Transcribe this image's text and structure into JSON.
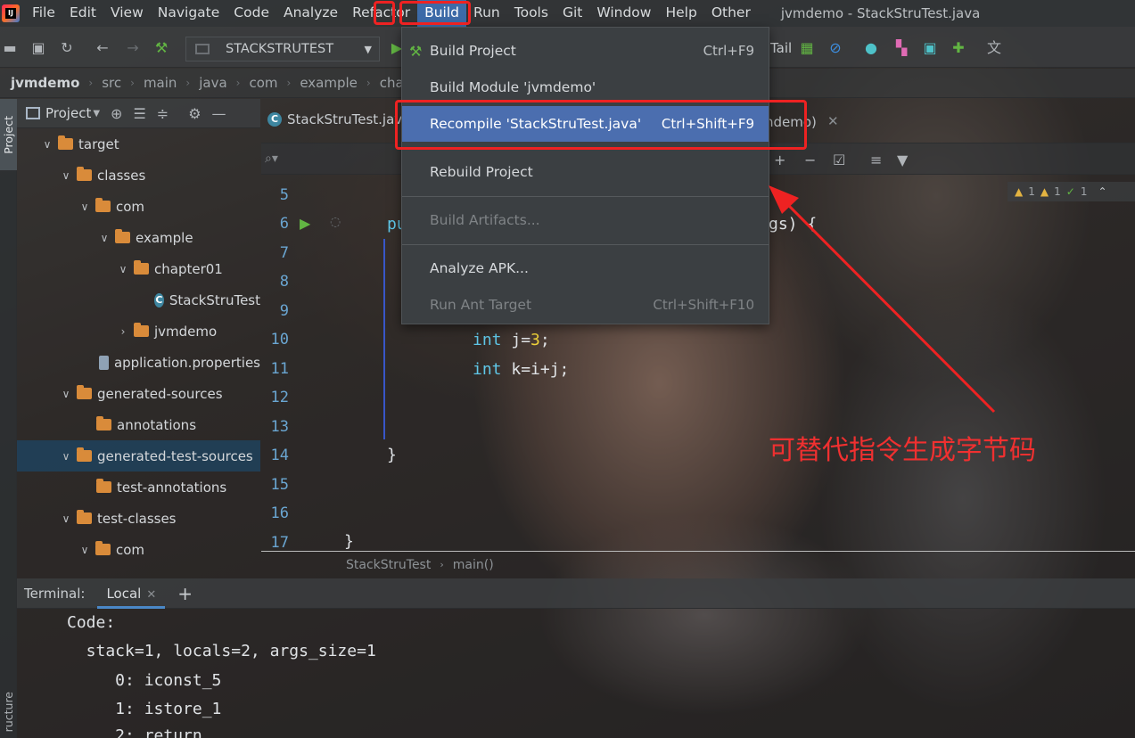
{
  "menubar": {
    "items": [
      "File",
      "Edit",
      "View",
      "Navigate",
      "Code",
      "Analyze",
      "Refactor",
      "Build",
      "Run",
      "Tools",
      "Git",
      "Window",
      "Help",
      "Other"
    ],
    "window_title": "jvmdemo - StackStruTest.java"
  },
  "toolbar": {
    "run_config": "STACKSTRUTEST",
    "tail_text": "Tail"
  },
  "breadcrumb": [
    "jvmdemo",
    "src",
    "main",
    "java",
    "com",
    "example",
    "chap"
  ],
  "side_tabs": {
    "project": "Project",
    "structure": "ructure"
  },
  "project_panel": {
    "title": "Project",
    "tree": [
      {
        "label": "target",
        "type": "folder",
        "expanded": true
      },
      {
        "label": "classes",
        "type": "folder",
        "expanded": true
      },
      {
        "label": "com",
        "type": "folder",
        "expanded": true
      },
      {
        "label": "example",
        "type": "folder",
        "expanded": true
      },
      {
        "label": "chapter01",
        "type": "folder",
        "expanded": true
      },
      {
        "label": "StackStruTest",
        "type": "class"
      },
      {
        "label": "jvmdemo",
        "type": "folder",
        "expanded": false
      },
      {
        "label": "application.properties",
        "type": "properties"
      },
      {
        "label": "generated-sources",
        "type": "folder",
        "expanded": true
      },
      {
        "label": "annotations",
        "type": "folder"
      },
      {
        "label": "generated-test-sources",
        "type": "folder",
        "expanded": true,
        "selected": true
      },
      {
        "label": "test-annotations",
        "type": "folder"
      },
      {
        "label": "test-classes",
        "type": "folder",
        "expanded": true
      },
      {
        "label": "com",
        "type": "folder",
        "expanded": true
      }
    ]
  },
  "editor": {
    "tab_label": "StackStruTest.java",
    "tab_suffix": "ndemo)",
    "line_numbers": [
      "5",
      "6",
      "7",
      "8",
      "9",
      "10",
      "11",
      "12",
      "13",
      "14",
      "15",
      "16",
      "17"
    ],
    "code_line6_start": "pu",
    "code_line6_end": "gs) {",
    "code_line10": {
      "kw": "int",
      "var": "j",
      "op": "=",
      "num": "3",
      "end": ";"
    },
    "code_line11": {
      "kw": "int",
      "text": "k=i+j;"
    },
    "code_line14": "}",
    "code_line17": "}",
    "inspection_counts": [
      "1",
      "1",
      "1"
    ],
    "breadcrumb": [
      "StackStruTest",
      "main()"
    ]
  },
  "build_menu": {
    "items": [
      {
        "label": "Build Project",
        "shortcut": "Ctrl+F9",
        "enabled": true
      },
      {
        "label": "Build Module 'jvmdemo'",
        "shortcut": "",
        "enabled": true
      },
      {
        "label": "Recompile 'StackStruTest.java'",
        "shortcut": "Ctrl+Shift+F9",
        "enabled": true,
        "highlighted": true
      },
      {
        "label": "Rebuild Project",
        "shortcut": "",
        "enabled": true
      },
      {
        "label": "Build Artifacts...",
        "shortcut": "",
        "enabled": false
      },
      {
        "label": "Analyze APK...",
        "shortcut": "",
        "enabled": true
      },
      {
        "label": "Run Ant Target",
        "shortcut": "Ctrl+Shift+F10",
        "enabled": false
      }
    ]
  },
  "terminal": {
    "label": "Terminal:",
    "tab": "Local",
    "lines": [
      "Code:",
      "  stack=1, locals=2, args_size=1",
      "     0: iconst_5",
      "     1: istore_1",
      "     2: return"
    ]
  },
  "annotation": {
    "text": "可替代指令生成字节码",
    "color": "#f03030"
  },
  "colors": {
    "accent": "#4b6eaf",
    "highlight_box": "#ee2222",
    "keyword": "#5fc7e8",
    "number": "#f0d33a",
    "line_number": "#6aa6d2"
  }
}
